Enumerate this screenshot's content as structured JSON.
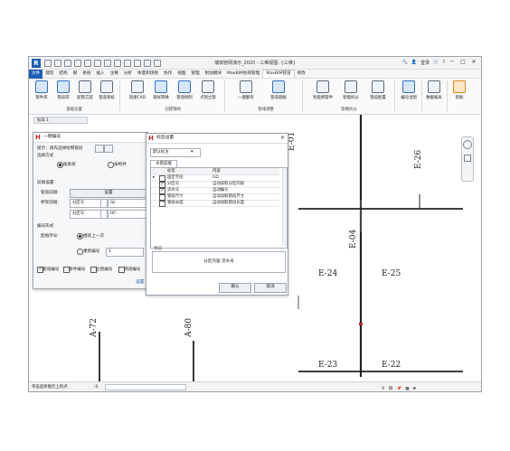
{
  "app": {
    "title": "瑞琪管网演示_2020 - 三维视图: {三维}",
    "logo": "R",
    "user": "登录",
    "window_controls": [
      "─",
      "□",
      "✕"
    ]
  },
  "menubar": [
    "文件",
    "建筑",
    "结构",
    "钢",
    "系统",
    "插入",
    "注释",
    "分析",
    "体量和场地",
    "协作",
    "视图",
    "管理",
    "附加模块",
    "MaxBIM协同管理",
    "MaxBIM管道",
    "修改"
  ],
  "ribbon": {
    "buttons": [
      "管件库",
      "管段库",
      "配管方案",
      "管道系统",
      "链接CAD",
      "链样转换",
      "管道绘制",
      "点到立管",
      "一键翻弯",
      "管道避碰",
      "智能侧管件",
      "智能拆分",
      "管段配置",
      "编号出图",
      "数据报表",
      "帮助"
    ],
    "groups": [
      "基础设置",
      "创建管网",
      "管线调整",
      "管路拆分"
    ]
  },
  "view_tab": "标高 1",
  "status": {
    "hint": "单击选择图元上的点",
    "zero": ":0"
  },
  "drawing": {
    "tags": [
      "E-01",
      "E-26",
      "E-04",
      "E-24",
      "E-25",
      "A-72",
      "A-80",
      "E-23",
      "E-22"
    ]
  },
  "dialog1": {
    "title": "一键编号",
    "tip": "提示：请先选择绘制管段",
    "choose_mode": "选择方式",
    "opt_system": "按系统",
    "opt_component": "按构件",
    "prefix_section": "前缀设置",
    "pipe_prefix_label": "管道前缀:",
    "pipe_prefix_btn": "设置",
    "cable_prefix_label": "桥架前缀:",
    "partition": "分区号",
    "cable_value": "HF-",
    "pipe_value": "GJ-",
    "numbering": "编号形式",
    "start_label": "起始序号:",
    "continue_label": "继续上一次",
    "restart_label": "重新编号",
    "restart_value": "1",
    "checks": [
      "管道编号",
      "管件编号",
      "立管编号",
      "绑道编号"
    ],
    "setting_link": "设置"
  },
  "dialog2": {
    "title": "标签设置",
    "template": "默认标注",
    "tab": "水管前缀",
    "col_tag": "标签",
    "col_content": "内容",
    "rows": [
      {
        "checked": false,
        "tag": "固定字段",
        "content": "GD"
      },
      {
        "checked": true,
        "tag": "分区号",
        "content": "自动读取分区内容"
      },
      {
        "checked": true,
        "tag": "流水号",
        "content": "自动编号"
      },
      {
        "checked": false,
        "tag": "管段尺寸",
        "content": "自动读取管段尺寸"
      },
      {
        "checked": false,
        "tag": "管段长度",
        "content": "自动读取管段长度"
      }
    ],
    "preview_label": "预览",
    "preview_text": "分区内容 流水号",
    "ok": "确认",
    "cancel": "取消"
  }
}
